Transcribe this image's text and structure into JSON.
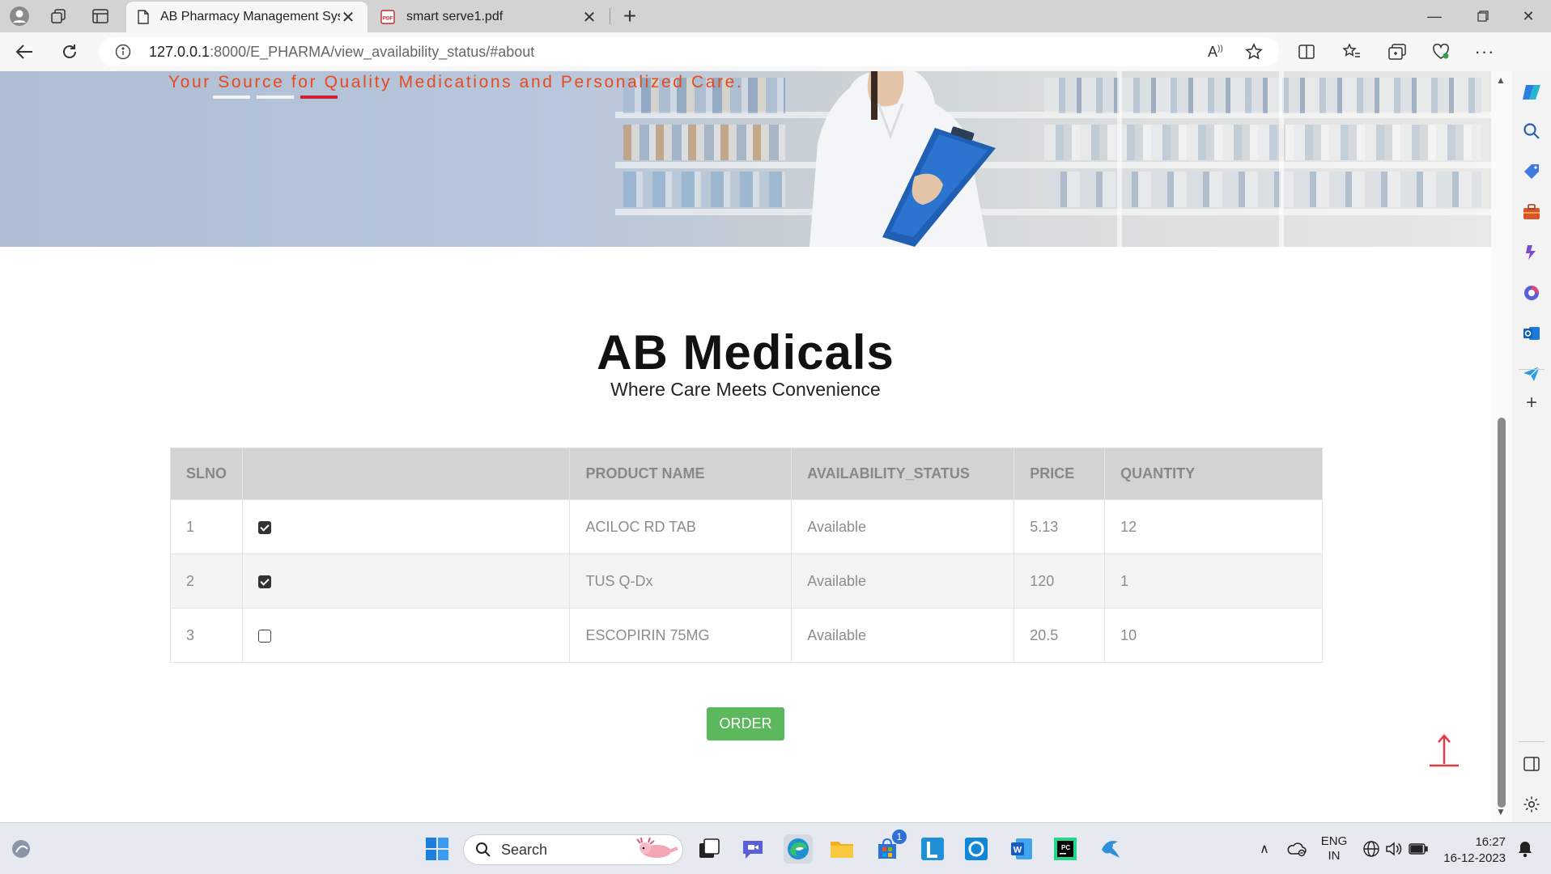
{
  "browser": {
    "tabs": [
      {
        "title": "AB Pharmacy Management System",
        "active": true
      },
      {
        "title": "smart serve1.pdf",
        "active": false
      }
    ],
    "address": {
      "host": "127.0.0.1",
      "path": ":8000/E_PHARMA/view_availability_status/#about"
    }
  },
  "hero": {
    "tagline": "Your Source for Quality Medications and Personalized Care."
  },
  "brand": {
    "title": "AB Medicals",
    "subtitle": "Where Care Meets Convenience"
  },
  "table": {
    "headers": [
      "SLNO",
      "",
      "PRODUCT NAME",
      "AVAILABILITY_STATUS",
      "PRICE",
      "QUANTITY"
    ],
    "rows": [
      {
        "slno": "1",
        "checked": true,
        "product": "ACILOC RD TAB",
        "status": "Available",
        "price": "5.13",
        "quantity": "12"
      },
      {
        "slno": "2",
        "checked": true,
        "product": "TUS Q-Dx",
        "status": "Available",
        "price": "120",
        "quantity": "1"
      },
      {
        "slno": "3",
        "checked": false,
        "product": "ESCOPIRIN 75MG",
        "status": "Available",
        "price": "20.5",
        "quantity": "10"
      }
    ]
  },
  "actions": {
    "order_label": "ORDER"
  },
  "taskbar": {
    "search_label": "Search",
    "store_badge": "1",
    "lang_top": "ENG",
    "lang_bottom": "IN",
    "time": "16:27",
    "date": "16-12-2023"
  },
  "colors": {
    "accent_green": "#5cb85c",
    "tagline_orange": "#e8491d",
    "scroll_top_red": "#e63946",
    "table_header_bg": "#d3d3d3"
  }
}
